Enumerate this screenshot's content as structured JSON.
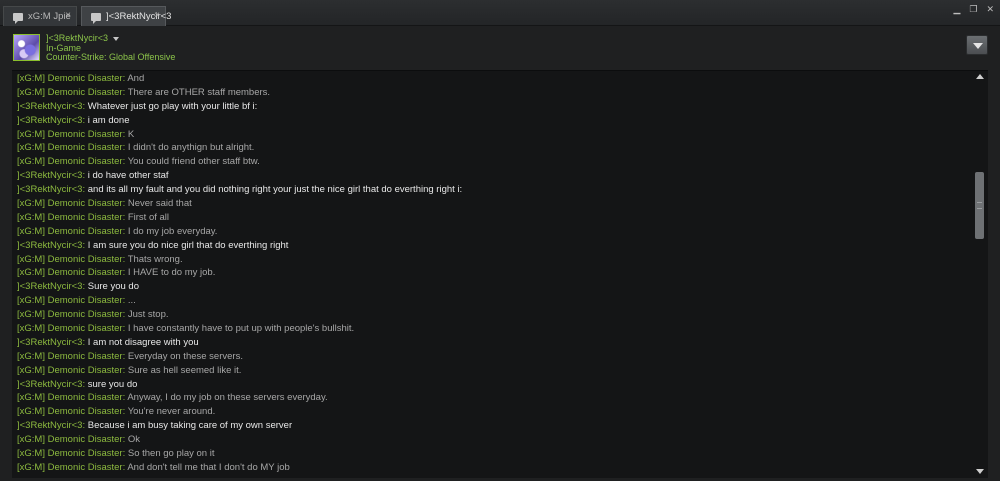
{
  "tabs": [
    {
      "label": "xG:M Jpie",
      "close": "×"
    },
    {
      "label": "]<3RektNycir<3",
      "close": "×"
    }
  ],
  "window_controls": {
    "minimize": "▁",
    "restore": "❐",
    "close": "✕"
  },
  "friend": {
    "name": "]<3RektNycir<3",
    "status": "In-Game",
    "game": "Counter-Strike: Global Offensive"
  },
  "colors": {
    "name_green": "#8cb93f",
    "background": "#1f2021",
    "chat_bg": "#141516"
  },
  "messages": [
    {
      "sender": "[xG:M] Demonic Disaster",
      "text": "And",
      "self": false
    },
    {
      "sender": "[xG:M] Demonic Disaster",
      "text": "There are OTHER staff members.",
      "self": false
    },
    {
      "sender": "]<3RektNycir<3",
      "text": "Whatever just go play with your little bf i:",
      "self": true
    },
    {
      "sender": "]<3RektNycir<3",
      "text": "i am done",
      "self": true
    },
    {
      "sender": "[xG:M] Demonic Disaster",
      "text": "K",
      "self": false
    },
    {
      "sender": "[xG:M] Demonic Disaster",
      "text": "I didn't do anythign but alright.",
      "self": false
    },
    {
      "sender": "[xG:M] Demonic Disaster",
      "text": "You could friend other staff btw.",
      "self": false
    },
    {
      "sender": "]<3RektNycir<3",
      "text": "i do have other staf",
      "self": true
    },
    {
      "sender": "]<3RektNycir<3",
      "text": "and its all my fault and you did nothing right your just the nice girl that do everthing right i:",
      "self": true
    },
    {
      "sender": "[xG:M] Demonic Disaster",
      "text": "Never said that",
      "self": false
    },
    {
      "sender": "[xG:M] Demonic Disaster",
      "text": "First of all",
      "self": false
    },
    {
      "sender": "[xG:M] Demonic Disaster",
      "text": "I do my job everyday.",
      "self": false
    },
    {
      "sender": "]<3RektNycir<3",
      "text": "I am sure you do nice girl that do everthing right",
      "self": true
    },
    {
      "sender": "[xG:M] Demonic Disaster",
      "text": "Thats wrong.",
      "self": false
    },
    {
      "sender": "[xG:M] Demonic Disaster",
      "text": "I HAVE to do my job.",
      "self": false
    },
    {
      "sender": "]<3RektNycir<3",
      "text": "Sure you do",
      "self": true
    },
    {
      "sender": "[xG:M] Demonic Disaster",
      "text": "...",
      "self": false
    },
    {
      "sender": "[xG:M] Demonic Disaster",
      "text": "Just stop.",
      "self": false
    },
    {
      "sender": "[xG:M] Demonic Disaster",
      "text": "I have constantly have to put up with people's bullshit.",
      "self": false
    },
    {
      "sender": "]<3RektNycir<3",
      "text": "I am not disagree with you",
      "self": true
    },
    {
      "sender": "[xG:M] Demonic Disaster",
      "text": "Everyday on these servers.",
      "self": false
    },
    {
      "sender": "[xG:M] Demonic Disaster",
      "text": "Sure as hell seemed like it.",
      "self": false
    },
    {
      "sender": "]<3RektNycir<3",
      "text": "sure you do",
      "self": true
    },
    {
      "sender": "[xG:M] Demonic Disaster",
      "text": "Anyway, I do my job on these servers everyday.",
      "self": false
    },
    {
      "sender": "[xG:M] Demonic Disaster",
      "text": "You're never around.",
      "self": false
    },
    {
      "sender": "]<3RektNycir<3",
      "text": "Because i am busy taking care of my own server",
      "self": true
    },
    {
      "sender": "[xG:M] Demonic Disaster",
      "text": "Ok",
      "self": false
    },
    {
      "sender": "[xG:M] Demonic Disaster",
      "text": "So then go play on it",
      "self": false
    },
    {
      "sender": "[xG:M] Demonic Disaster",
      "text": "And don't tell me that I don't do MY job",
      "self": false
    }
  ]
}
